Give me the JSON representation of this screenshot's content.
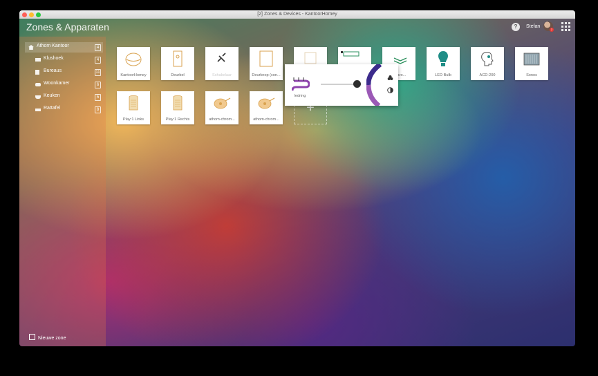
{
  "window": {
    "title": "[2] Zones & Devices - KantoorHomey"
  },
  "header": {
    "title": "Zones & Apparaten",
    "help_label": "?",
    "user_name": "Stefan",
    "notification_count": "2"
  },
  "sidebar": {
    "items": [
      {
        "label": "Athom Kantoor",
        "count": "4",
        "icon": "home-icon",
        "active": true
      },
      {
        "label": "Klushoek",
        "count": "4",
        "icon": "workbench-icon"
      },
      {
        "label": "Bureaus",
        "count": "11",
        "icon": "desk-icon"
      },
      {
        "label": "Woonkamer",
        "count": "6",
        "icon": "sofa-icon"
      },
      {
        "label": "Keuken",
        "count": "5",
        "icon": "pot-icon"
      },
      {
        "label": "Rattafel",
        "count": "8",
        "icon": "table-icon"
      }
    ],
    "new_zone_label": "Nieuwe zone"
  },
  "devices": [
    {
      "label": "KantoorHomey",
      "icon": "homey-icon"
    },
    {
      "label": "Deurbel",
      "icon": "doorbell-icon"
    },
    {
      "label": "Schakelaar",
      "icon": "switch-icon"
    },
    {
      "label": "Deurknop (con...",
      "icon": "door-sensor-icon"
    },
    {
      "label": "",
      "icon": "hidden-device-icon"
    },
    {
      "label": "",
      "icon": "led-strip-icon"
    },
    {
      "label": "Fibaro...",
      "icon": "dimmer-icon"
    },
    {
      "label": "LED Bulb",
      "icon": "bulb-icon"
    },
    {
      "label": "ACD-200",
      "icon": "speaker-head-icon"
    },
    {
      "label": "Sonos",
      "icon": "sonos-icon"
    },
    {
      "label": "Play:1 Links",
      "icon": "play1-icon"
    },
    {
      "label": "Play:1 Rechts",
      "icon": "play1-icon"
    },
    {
      "label": "athom-chrom...",
      "icon": "chromecast-icon"
    },
    {
      "label": "athom-chrom...",
      "icon": "chromecast-icon"
    }
  ],
  "add_device_symbol": "+",
  "popup": {
    "device_label": "ledring",
    "icon": "led-strip-icon",
    "brightness_fraction": 0.9,
    "mode_icon_1": "color-icon",
    "mode_icon_2": "contrast-icon"
  },
  "colors": {
    "accent_purple": "#8e44ad",
    "tile_bg": "#ffffff",
    "icon_gold": "#d9a24f",
    "icon_teal": "#1f8d86"
  }
}
